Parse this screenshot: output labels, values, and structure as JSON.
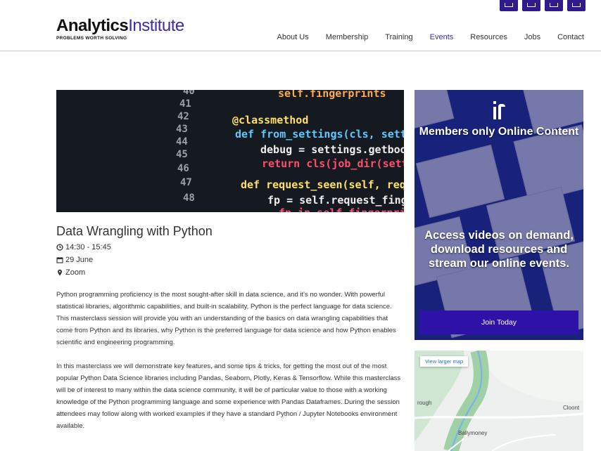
{
  "brand": {
    "name_bold": "Analytics",
    "name_light": "Institute",
    "tagline": "PROBLEMS WORTH SOLVING"
  },
  "nav": {
    "items": [
      "About Us",
      "Membership",
      "Training",
      "Events",
      "Resources",
      "Jobs",
      "Contact"
    ],
    "active": "Events"
  },
  "hero": {
    "line_numbers": [
      "40",
      "41",
      "42",
      "43",
      "44",
      "45",
      "46",
      "47",
      "48"
    ],
    "code_lines": [
      "self.fingerprints",
      "@classmethod",
      "def from_settings(cls, setti",
      "debug = settings.getbool",
      "return cls(job_dir(setti",
      "def request_seen(self, reque",
      "fp = self.request_finge",
      "fp in self.fingerpri"
    ]
  },
  "event": {
    "title": "Data Wrangling with Python",
    "time": "14:30 - 15:45",
    "date": "29 June",
    "location": "Zoom",
    "paragraphs": [
      "Python programming proficiency is the most sought-after skill in data science, and it's no wonder. With powerful statistical libraries, algorithmic capabilities, and built-in scalability, Python is the perfect language for data science. This masterclass session will provide you with an understanding of the basics on data wrangling capabilities that come from Python and its libraries, why Python is the preferred language for data science and how Python enables scientific and engineering programming.",
      "In this masterclass we will demonstrate key features, and some tips & tricks, for getting the most out of the most popular Python Data Science libraries including Pandas, Seaborn, Plotly, Keras & Tensorflow. While this masterclass will be of interest to many within the data science community, it will be of particular value to those with a working knowledge of the Python programming language and some experience with Pandas Dataframes. During the session attendees may follow along with worked examples if they have a standard Python / Jupyter Notebooks environment available."
    ]
  },
  "promo": {
    "heading": "Members only Online Content",
    "body": "Access videos on demand, download resources and stream our online events.",
    "join_label": "Join Today"
  },
  "map": {
    "view_larger": "View larger map",
    "labels": [
      "rough",
      "Cloont",
      "Ballymoney"
    ]
  },
  "colors": {
    "brand_purple": "#3f2aa8",
    "promo_blue": "#1c2a8a",
    "join_button": "#2e12a8"
  }
}
